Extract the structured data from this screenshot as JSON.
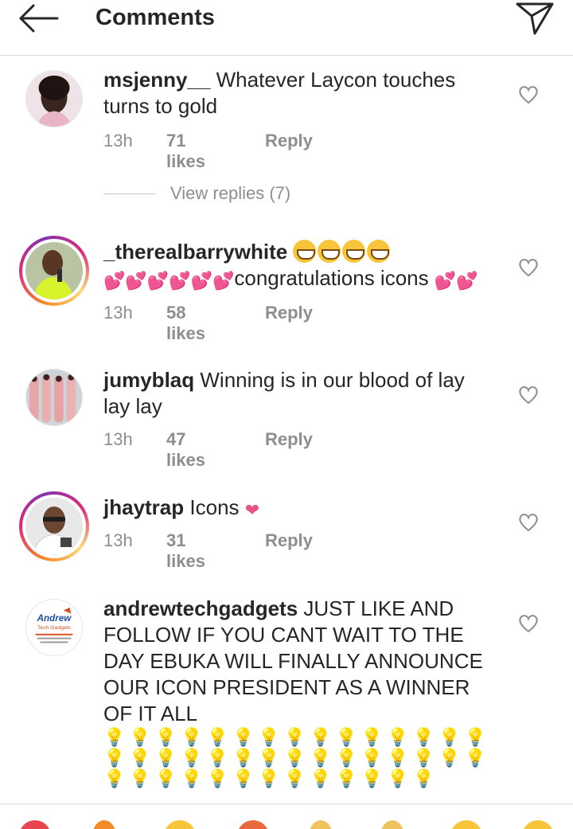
{
  "header": {
    "title": "Comments",
    "back_icon": "arrow-left-icon",
    "send_icon": "paper-plane-icon"
  },
  "comments": [
    {
      "username": "msjenny__",
      "text": "Whatever Laycon touches turns to gold",
      "time": "13h",
      "likes": "71 likes",
      "reply": "Reply"
    },
    {
      "username": "_therealbarrywhite",
      "text": "congratulations icons",
      "emoji_prefix": "😁😁😁😁💕💕💕💕💕💕",
      "emoji_suffix": "💕💕",
      "time": "13h",
      "likes": "58 likes",
      "reply": "Reply"
    },
    {
      "username": "jumyblaq",
      "text": "Winning is in our blood of lay lay lay",
      "time": "13h",
      "likes": "47 likes",
      "reply": "Reply"
    },
    {
      "username": "jhaytrap",
      "text": "Icons",
      "emoji_suffix": "❤",
      "time": "13h",
      "likes": "31 likes",
      "reply": "Reply"
    },
    {
      "username": "andrewtechgadgets",
      "text": "JUST LIKE AND FOLLOW IF YOU CANT WAIT TO THE DAY EBUKA WILL FINALLY ANNOUNCE OUR ICON PRESIDENT AS A WINNER OF IT ALL",
      "emoji_suffix": "💡💡💡💡💡💡💡💡💡💡💡💡💡💡💡💡💡💡💡💡💡💡💡💡💡💡💡💡💡💡💡💡💡💡💡💡💡💡💡💡💡💡💡",
      "logo_text": "Andrew Tech Gadgets"
    }
  ],
  "view_replies": "View replies (7)",
  "colors": {
    "text": "#262626",
    "muted": "#8e8e8e",
    "divider": "#dbdbdb",
    "heart_outline": "#8e8e8e"
  }
}
